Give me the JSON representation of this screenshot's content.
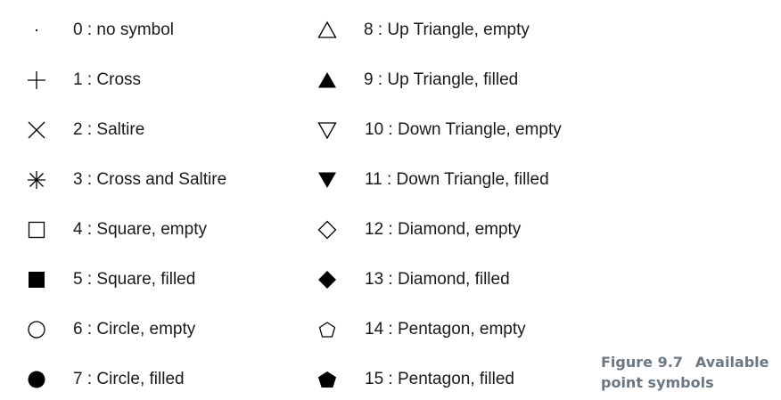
{
  "symbols": [
    {
      "label": "0 : no symbol",
      "icon": "dot-icon"
    },
    {
      "label": "1 : Cross",
      "icon": "cross-icon"
    },
    {
      "label": "2 : Saltire",
      "icon": "saltire-icon"
    },
    {
      "label": "3 : Cross and Saltire",
      "icon": "asterisk-icon"
    },
    {
      "label": "4 : Square, empty",
      "icon": "square-empty-icon"
    },
    {
      "label": "5 : Square, filled",
      "icon": "square-filled-icon"
    },
    {
      "label": "6 : Circle, empty",
      "icon": "circle-empty-icon"
    },
    {
      "label": "7 : Circle, filled",
      "icon": "circle-filled-icon"
    },
    {
      "label": "8 : Up Triangle, empty",
      "icon": "up-triangle-empty-icon"
    },
    {
      "label": "9 : Up Triangle, filled",
      "icon": "up-triangle-filled-icon"
    },
    {
      "label": "10 : Down Triangle, empty",
      "icon": "down-triangle-empty-icon"
    },
    {
      "label": "11 : Down Triangle, filled",
      "icon": "down-triangle-filled-icon"
    },
    {
      "label": "12 : Diamond, empty",
      "icon": "diamond-empty-icon"
    },
    {
      "label": "13 : Diamond, filled",
      "icon": "diamond-filled-icon"
    },
    {
      "label": "14 : Pentagon, empty",
      "icon": "pentagon-empty-icon"
    },
    {
      "label": "15 : Pentagon, filled",
      "icon": "pentagon-filled-icon"
    }
  ],
  "caption": {
    "number": "Figure 9.7",
    "text_line1": "Available",
    "text_line2": "point symbols"
  },
  "colors": {
    "symbol": "#000000",
    "text": "#1a1a1a",
    "caption": "#6b7884"
  }
}
